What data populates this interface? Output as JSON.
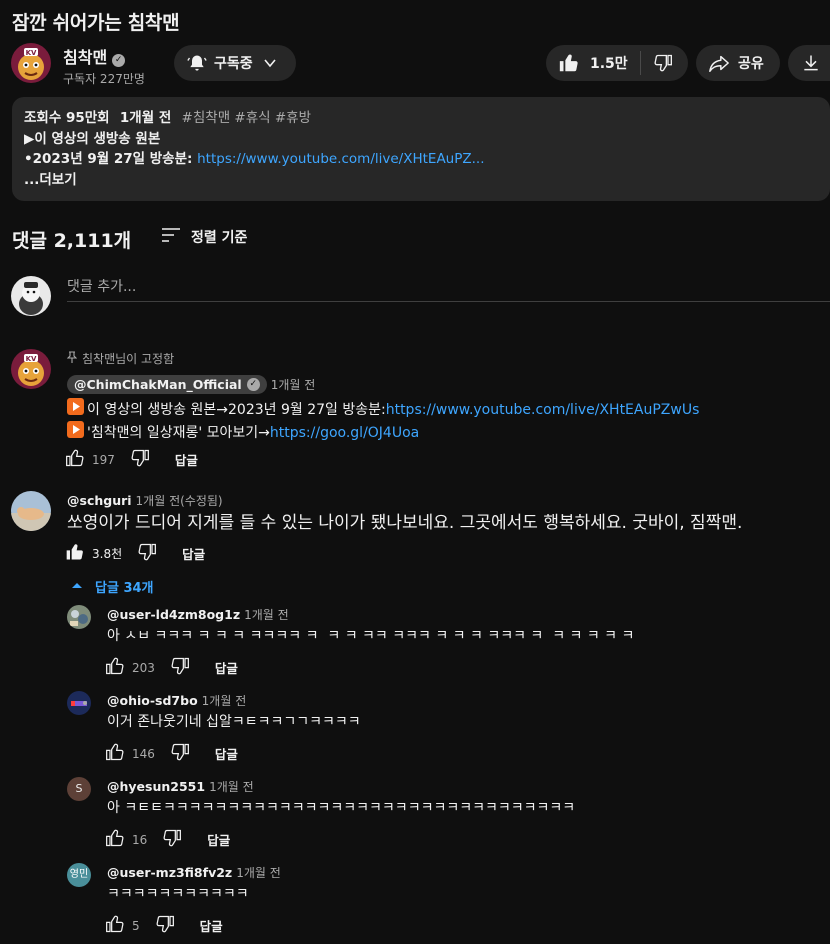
{
  "video": {
    "title": "잠깐 쉬어가는 침착맨"
  },
  "channel": {
    "name": "침착맨",
    "subscribers": "구독자 227만명",
    "verified_glyph": "✓"
  },
  "actions": {
    "subscribe_label": "구독중",
    "likes": "1.5만",
    "share_label": "공유"
  },
  "description": {
    "views": "조회수 95만회",
    "date": "1개월 전",
    "tags": "#침착맨 #휴식 #휴방",
    "line1": "▶이 영상의 생방송 원본",
    "line2_prefix": "•2023년 9월 27일 방송분: ",
    "line2_link": "https://www.youtube.com/live/XHtEAuPZ...",
    "more": "...더보기"
  },
  "comments_header": {
    "count": "댓글 2,111개",
    "sort_label": "정렬 기준"
  },
  "add_comment": {
    "placeholder": "댓글 추가..."
  },
  "pinned": {
    "pin_label": "침착맨님이 고정함",
    "author": "@ChimChakMan_Official",
    "time": "1개월 전",
    "line1_text": "이 영상의 생방송 원본→2023년 9월 27일 방송분: ",
    "line1_link": "https://www.youtube.com/live/XHtEAuPZwUs",
    "line2_text": "'침착맨의 일상재롱' 모아보기→",
    "line2_link": "https://goo.gl/OJ4Uoa",
    "likes": "197",
    "reply_label": "답글"
  },
  "top_comment": {
    "author": "@schguri",
    "time": "1개월 전(수정됨)",
    "text": "쏘영이가 드디어 지게를 들 수 있는 나이가 됐나보네요. 그곳에서도 행복하세요. 굿바이, 짐짝맨.",
    "likes": "3.8천",
    "reply_label": "답글",
    "replies_toggle": "답글 34개"
  },
  "replies": [
    {
      "author": "@user-ld4zm8og1z",
      "time": "1개월 전",
      "text": "아 ㅅㅂ ㅋㅋㅋ ㅋ ㅋ ㅋ ㅋㅋㅋㅋ ㅋ  ㅋ ㅋ ㅋㅋ ㅋㅋㅋ ㅋ ㅋ ㅋ ㅋㅋㅋ ㅋ  ㅋ ㅋ ㅋ ㅋ ㅋ",
      "likes": "203",
      "reply_label": "답글",
      "avatar_initial": ""
    },
    {
      "author": "@ohio-sd7bo",
      "time": "1개월 전",
      "text": "이거 존나웃기네 십알ㅋㅌㅋㅋㄱㄱㅋㅋㅋㅋ",
      "likes": "146",
      "reply_label": "답글",
      "avatar_initial": ""
    },
    {
      "author": "@hyesun2551",
      "time": "1개월 전",
      "text": "아 ㅋㅌㅌㅋㅋㅋㅋㅋㅋㅋㅋㅋㅋㅋㅋㅋㅋㅋㅋㅋㅋㅋㅋㅋㅋㅋㅋㅋㅋㅋㅋㅋㅋㅋㅋ",
      "likes": "16",
      "reply_label": "답글",
      "avatar_initial": "S"
    },
    {
      "author": "@user-mz3fi8fv2z",
      "time": "1개월 전",
      "text": "ㅋㅋㅋㅋㅋㅋㅋㅋㅋㅋㅋ",
      "likes": "5",
      "reply_label": "답글",
      "avatar_initial": "영민"
    }
  ],
  "colors": {
    "background": "#0f0f0f",
    "link": "#3ea6ff",
    "pill": "#272727",
    "muted": "#aaaaaa",
    "play_orange": "#f26b1d"
  }
}
